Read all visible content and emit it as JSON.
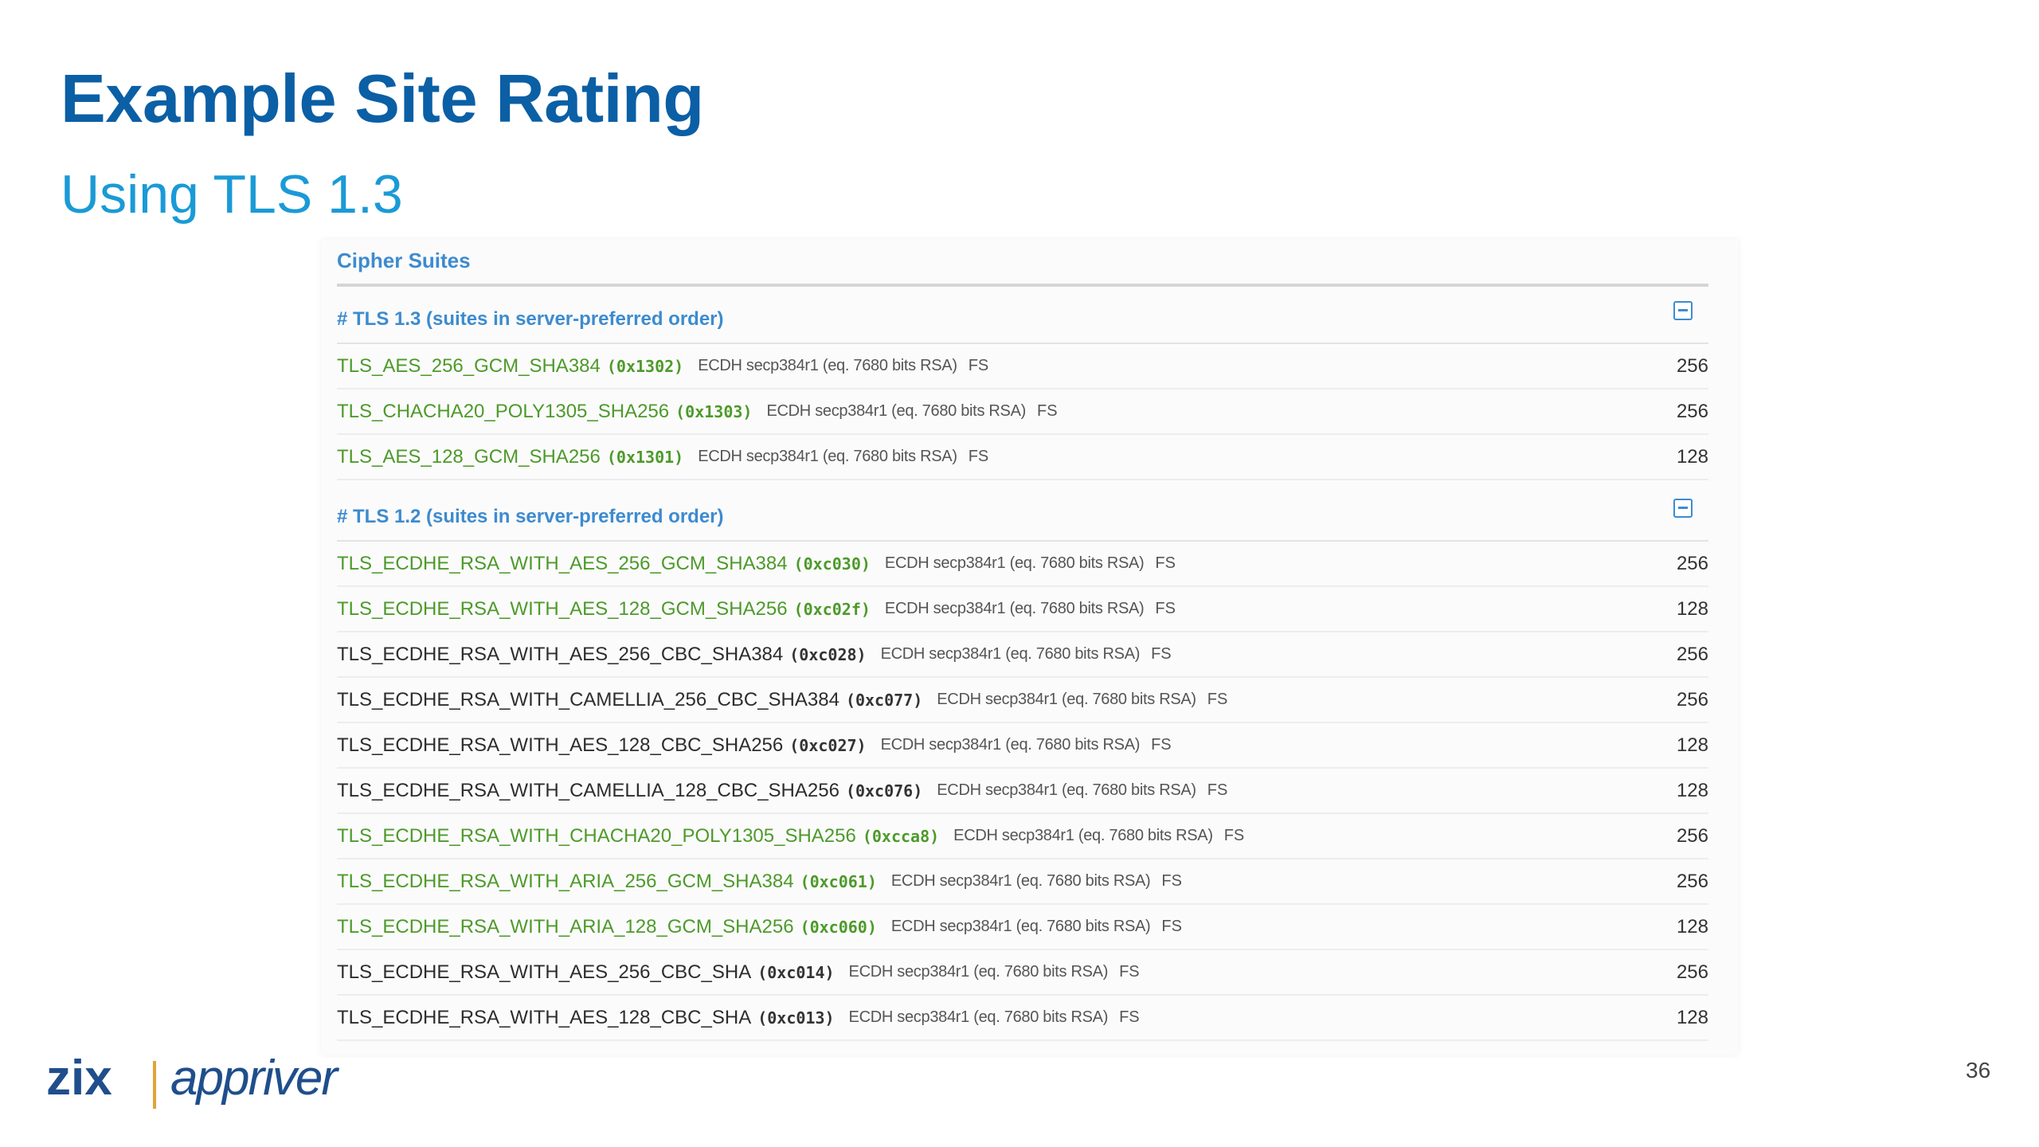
{
  "slide": {
    "title": "Example Site Rating",
    "subtitle": "Using TLS 1.3",
    "page_number": "36"
  },
  "panel": {
    "title": "Cipher Suites",
    "sections": [
      {
        "label": "# TLS 1.3 (suites in server-preferred order)",
        "rows": [
          {
            "suite": "TLS_AES_256_GCM_SHA384",
            "code": "(0x1302)",
            "kex": "ECDH secp384r1 (eq. 7680 bits RSA)",
            "fs": "FS",
            "bits": "256",
            "color": "green"
          },
          {
            "suite": "TLS_CHACHA20_POLY1305_SHA256",
            "code": "(0x1303)",
            "kex": "ECDH secp384r1 (eq. 7680 bits RSA)",
            "fs": "FS",
            "bits": "256",
            "color": "green"
          },
          {
            "suite": "TLS_AES_128_GCM_SHA256",
            "code": "(0x1301)",
            "kex": "ECDH secp384r1 (eq. 7680 bits RSA)",
            "fs": "FS",
            "bits": "128",
            "color": "green"
          }
        ]
      },
      {
        "label": "# TLS 1.2 (suites in server-preferred order)",
        "rows": [
          {
            "suite": "TLS_ECDHE_RSA_WITH_AES_256_GCM_SHA384",
            "code": "(0xc030)",
            "kex": "ECDH secp384r1 (eq. 7680 bits RSA)",
            "fs": "FS",
            "bits": "256",
            "color": "green"
          },
          {
            "suite": "TLS_ECDHE_RSA_WITH_AES_128_GCM_SHA256",
            "code": "(0xc02f)",
            "kex": "ECDH secp384r1 (eq. 7680 bits RSA)",
            "fs": "FS",
            "bits": "128",
            "color": "green"
          },
          {
            "suite": "TLS_ECDHE_RSA_WITH_AES_256_CBC_SHA384",
            "code": "(0xc028)",
            "kex": "ECDH secp384r1 (eq. 7680 bits RSA)",
            "fs": "FS",
            "bits": "256",
            "color": "black"
          },
          {
            "suite": "TLS_ECDHE_RSA_WITH_CAMELLIA_256_CBC_SHA384",
            "code": "(0xc077)",
            "kex": "ECDH secp384r1 (eq. 7680 bits RSA)",
            "fs": "FS",
            "bits": "256",
            "color": "black"
          },
          {
            "suite": "TLS_ECDHE_RSA_WITH_AES_128_CBC_SHA256",
            "code": "(0xc027)",
            "kex": "ECDH secp384r1 (eq. 7680 bits RSA)",
            "fs": "FS",
            "bits": "128",
            "color": "black"
          },
          {
            "suite": "TLS_ECDHE_RSA_WITH_CAMELLIA_128_CBC_SHA256",
            "code": "(0xc076)",
            "kex": "ECDH secp384r1 (eq. 7680 bits RSA)",
            "fs": "FS",
            "bits": "128",
            "color": "black"
          },
          {
            "suite": "TLS_ECDHE_RSA_WITH_CHACHA20_POLY1305_SHA256",
            "code": "(0xcca8)",
            "kex": "ECDH secp384r1 (eq. 7680 bits RSA)",
            "fs": "FS",
            "bits": "256",
            "color": "green"
          },
          {
            "suite": "TLS_ECDHE_RSA_WITH_ARIA_256_GCM_SHA384",
            "code": "(0xc061)",
            "kex": "ECDH secp384r1 (eq. 7680 bits RSA)",
            "fs": "FS",
            "bits": "256",
            "color": "green"
          },
          {
            "suite": "TLS_ECDHE_RSA_WITH_ARIA_128_GCM_SHA256",
            "code": "(0xc060)",
            "kex": "ECDH secp384r1 (eq. 7680 bits RSA)",
            "fs": "FS",
            "bits": "128",
            "color": "green"
          },
          {
            "suite": "TLS_ECDHE_RSA_WITH_AES_256_CBC_SHA",
            "code": "(0xc014)",
            "kex": "ECDH secp384r1 (eq. 7680 bits RSA)",
            "fs": "FS",
            "bits": "256",
            "color": "black"
          },
          {
            "suite": "TLS_ECDHE_RSA_WITH_AES_128_CBC_SHA",
            "code": "(0xc013)",
            "kex": "ECDH secp384r1 (eq. 7680 bits RSA)",
            "fs": "FS",
            "bits": "128",
            "color": "black"
          }
        ]
      }
    ]
  },
  "logo": {
    "brand_primary": "zix",
    "brand_secondary": "appriver",
    "colors": {
      "zix": "#1f4e8c",
      "divider": "#e0a43a",
      "appriver": "#1f4e8c"
    }
  },
  "colors": {
    "title": "#0b5fa5",
    "subtitle": "#1a9ad6",
    "strong_cipher": "#4d9a2a",
    "section_label": "#3d8bcf"
  }
}
